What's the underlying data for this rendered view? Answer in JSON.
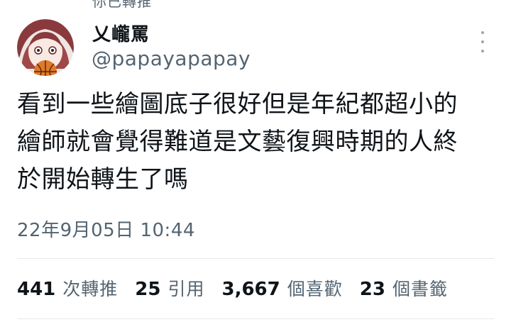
{
  "header": {
    "retweet_context": "你已轉推"
  },
  "author": {
    "display_name": "乂巄罵",
    "handle": "@papayapapay",
    "avatar_icon": "anime-girl-avatar-icon"
  },
  "more_icon": "vertical-ellipsis-icon",
  "tweet": {
    "text_lines": [
      "看到一些繪圖底子很好但是年紀都超小的",
      "繪師就會覺得難道是文藝復興時期的人終",
      "於開始轉生了嗎"
    ],
    "timestamp": "22年9月05日 10:44"
  },
  "stats": {
    "retweets": {
      "count": "441",
      "label": "次轉推"
    },
    "quotes": {
      "count": "25",
      "label": "引用"
    },
    "likes": {
      "count": "3,667",
      "label": "個喜歡"
    },
    "bookmarks": {
      "count": "23",
      "label": "個書籤"
    }
  },
  "colors": {
    "primary_text": "#0f1419",
    "secondary_text": "#536471",
    "divider": "#e4e8eb"
  }
}
